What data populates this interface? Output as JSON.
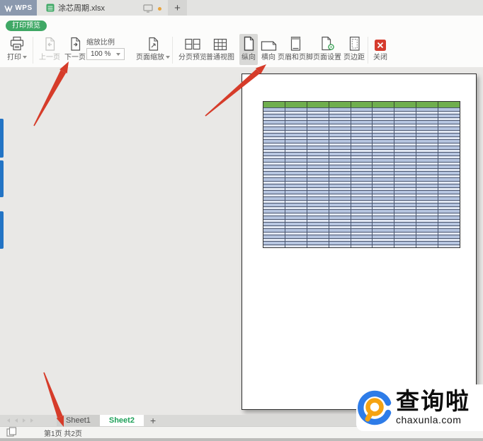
{
  "titlebar": {
    "app_name": "WPS",
    "document_tab": "涂芯周期.xlsx",
    "new_tab": "+"
  },
  "preview_badge": "打印预览",
  "toolbar": {
    "print": "打印",
    "prev_page": "上一页",
    "next_page": "下一页",
    "zoom_ratio_label": "缩放比例",
    "zoom_value": "100 %",
    "page_zoom": "页面缩放",
    "page_break_preview": "分页预览",
    "normal_view": "普通视图",
    "portrait": "纵向",
    "landscape": "横向",
    "header_footer": "页眉和页脚",
    "page_setup": "页面设置",
    "page_margins": "页边距",
    "close": "关闭"
  },
  "preview": {
    "table": {
      "columns": 9,
      "row_pairs": 22,
      "header_color": "#6fae4e",
      "row_color_dark": "#b6c5e0",
      "row_color_light": "#e2e8f3",
      "border_color": "#49556f",
      "outer_border": "#333333"
    }
  },
  "sheet_bar": {
    "tabs": [
      {
        "label": "Sheet1",
        "active": false
      },
      {
        "label": "Sheet2",
        "active": true
      }
    ],
    "add_tab": "+"
  },
  "status_bar": {
    "page_info": "第1页 共2页"
  },
  "watermark": {
    "title": "查询啦",
    "domain": "chaxunla.com"
  },
  "colors": {
    "accent_green": "#3fa865",
    "active_sheet_green": "#1fa15a",
    "arrow_red": "#d63c2a",
    "close_red": "#d53b2d",
    "wps_block_blue_gray": "#8b99ae",
    "left_dock_blue": "#2374c5"
  }
}
